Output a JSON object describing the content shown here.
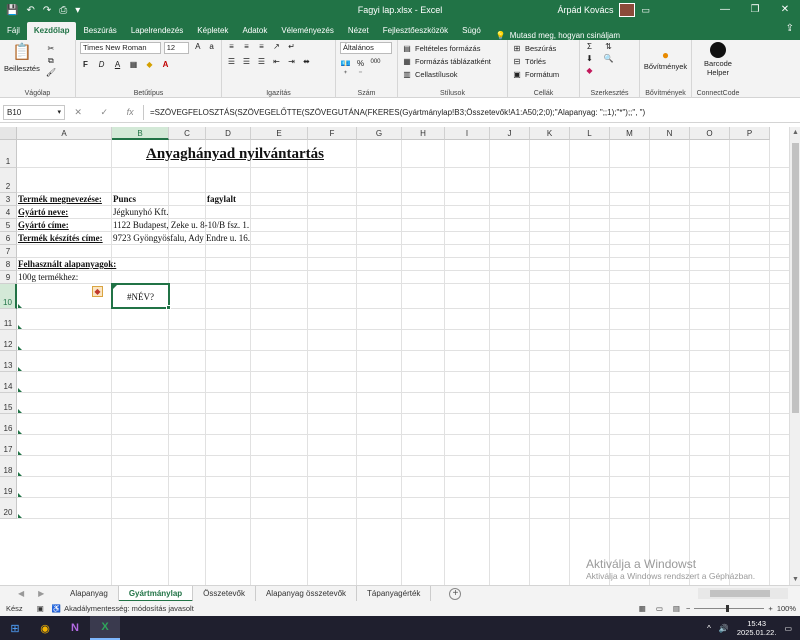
{
  "titlebar": {
    "doc_title": "Fagyi lap.xlsx  -  Excel",
    "user_name": "Árpád Kovács",
    "minimize": "—",
    "restore": "❐",
    "close": "✕",
    "ribbon_display": "▭",
    "qa_save": "💾",
    "qa_undo": "↶",
    "qa_redo": "↷",
    "qa_preview": "⎙",
    "qa_more": "▾"
  },
  "tabs": {
    "items": [
      "Fájl",
      "Kezdőlap",
      "Beszúrás",
      "Lapelrendezés",
      "Képletek",
      "Adatok",
      "Véleményezés",
      "Nézet",
      "Fejlesztőeszközök",
      "Súgó"
    ],
    "tell_me": "Mutasd meg, hogyan csináljam",
    "share": "⇪"
  },
  "ribbon": {
    "clipboard": {
      "paste": "Beillesztés",
      "label": "Vágólap"
    },
    "font": {
      "name": "Times New Roman",
      "size": "12",
      "bold": "F",
      "italic": "D",
      "underline": "A",
      "label": "Betűtípus"
    },
    "alignment": {
      "label": "Igazítás"
    },
    "number": {
      "format": "Általános",
      "percent": "%",
      "thousands": "000",
      "label": "Szám"
    },
    "styles": {
      "conditional": "Feltételes formázás",
      "as_table": "Formázás táblázatként",
      "cell_styles": "Cellastílusok",
      "label": "Stílusok"
    },
    "cells": {
      "insert": "Beszúrás",
      "delete": "Törlés",
      "format": "Formátum",
      "label": "Cellák"
    },
    "editing": {
      "label": "Szerkesztés"
    },
    "addins": {
      "button": "Bővítmények",
      "label": "Bővítmények"
    },
    "connectcode": {
      "button_line1": "Barcode",
      "button_line2": "Helper",
      "label": "ConnectCode"
    }
  },
  "formula_bar": {
    "name_box": "B10",
    "cancel": "✕",
    "enter": "✓",
    "fx": "fx",
    "formula": "=SZÖVEGFELOSZTÁS(SZÖVEGELŐTTE(SZÖVEGUTÁNA(FKERES(Gyártmánylap!B3;Összetevők!A1:A50;2;0);\"Alapanyag: \";;1);\"*\");;\", \")"
  },
  "columns": [
    "A",
    "B",
    "C",
    "D",
    "E",
    "F",
    "G",
    "H",
    "I",
    "J",
    "K",
    "L",
    "M",
    "N",
    "O",
    "P"
  ],
  "rows": [
    "1",
    "2",
    "3",
    "4",
    "5",
    "6",
    "7",
    "8",
    "9",
    "10",
    "11",
    "12",
    "13",
    "14",
    "15",
    "16",
    "17",
    "18",
    "19",
    "20"
  ],
  "cells": {
    "title": "Anyaghányad nyilvántartás",
    "a3": "Termék megnevezése:",
    "b3": "Puncs",
    "d3": "fagylalt",
    "a4": "Gyártó neve:",
    "b4": "Jégkunyhó Kft.",
    "a5": "Gyártó címe:",
    "b5": "1122 Budapest, Zeke u. 8-10/B fsz. 1.",
    "a6": "Termék készítés címe:",
    "b6": "9723 Gyöngyösfalu, Ady Endre u. 16.",
    "a8": "Felhasznált alapanyagok:",
    "a9": "100g termékhez:",
    "b10": "#NÉV?"
  },
  "sheets": [
    "Alapanyag",
    "Gyártmánylap",
    "Összetevők",
    "Alapanyag összetevők",
    "Tápanyagérték"
  ],
  "active_sheet": "Gyártmánylap",
  "statusbar": {
    "ready": "Kész",
    "accessibility": "Akadálymentesség: módosítás javasolt",
    "zoom": "100%",
    "zoom_minus": "−",
    "zoom_plus": "+"
  },
  "watermark": {
    "line1": "Aktiválja a Windowst",
    "line2": "Aktiválja a Windows rendszert a Gépházban."
  },
  "taskbar": {
    "time": "15:43",
    "date": "2025.01.22.",
    "lang": "^",
    "volume": "🔊"
  },
  "colors": {
    "accent": "#217346",
    "taskbar": "#1f1f2e"
  }
}
